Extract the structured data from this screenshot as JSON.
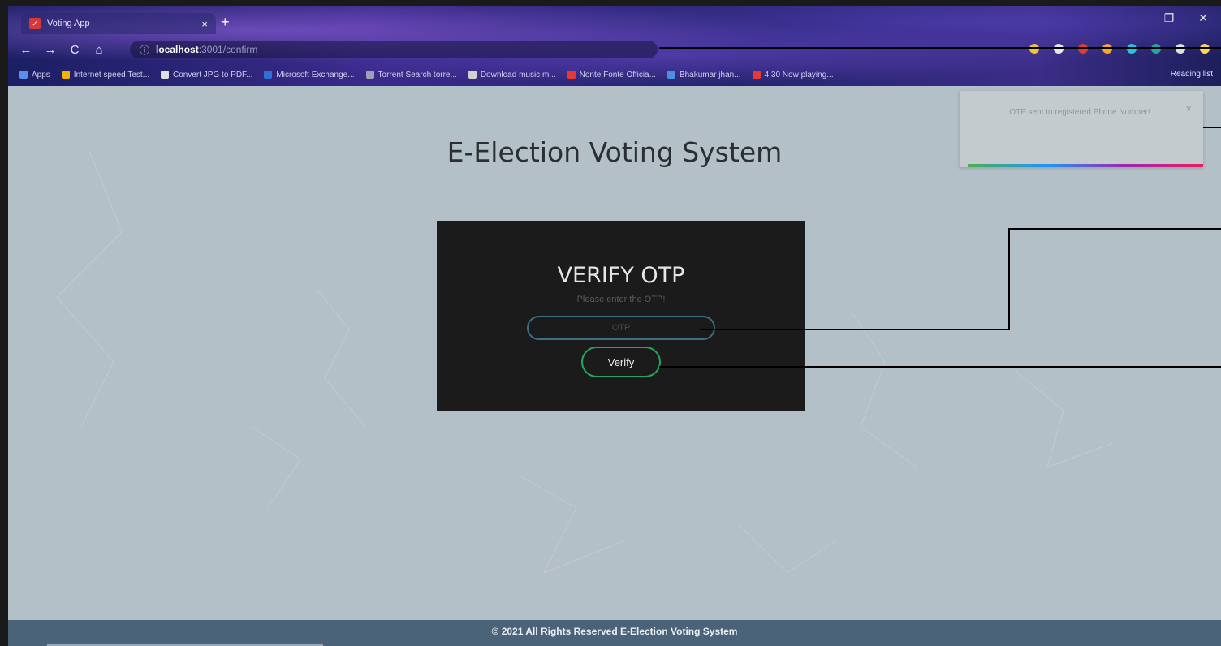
{
  "browser": {
    "tab_title": "Voting App",
    "tab_close": "×",
    "new_tab": "+",
    "window_controls": {
      "minimize": "–",
      "maximize": "❐",
      "close": "✕"
    },
    "nav": {
      "back": "←",
      "forward": "→",
      "reload": "C",
      "home": "⌂"
    },
    "address": {
      "info_icon": "ⓘ",
      "host": "localhost",
      "path": ":3001/confirm"
    },
    "bookmarks": [
      {
        "label": "Apps",
        "color": "#5b8def"
      },
      {
        "label": "Internet speed Test...",
        "color": "#f6b100"
      },
      {
        "label": "Convert JPG to PDF...",
        "color": "#e0e0e0"
      },
      {
        "label": "Microsoft Exchange...",
        "color": "#2f6fd6"
      },
      {
        "label": "Torrent Search torre...",
        "color": "#9aa0b8"
      },
      {
        "label": "Download music m...",
        "color": "#d0d0d0"
      },
      {
        "label": "Nonte Fonte Officia...",
        "color": "#e53935"
      },
      {
        "label": "Bhakumar jhan...",
        "color": "#4a90e2"
      },
      {
        "label": "4:30 Now playing...",
        "color": "#e53935"
      }
    ],
    "reading_list": "Reading list"
  },
  "page": {
    "title": "E-Election Voting System",
    "card": {
      "heading": "VERIFY OTP",
      "subtitle": "Please enter the OTP!",
      "otp_placeholder": "OTP",
      "verify_label": "Verify"
    },
    "toast": {
      "message": "OTP sent to registered Phone Number!",
      "close": "×"
    },
    "footer": "© 2021 All Rights Reserved E-Election Voting System"
  },
  "colors": {
    "page_background": "#b4c0c7",
    "card_background": "#1b1b1b",
    "input_border": "#3d6f83",
    "verify_border": "#27a55e",
    "footer_background": "#4a6378"
  }
}
